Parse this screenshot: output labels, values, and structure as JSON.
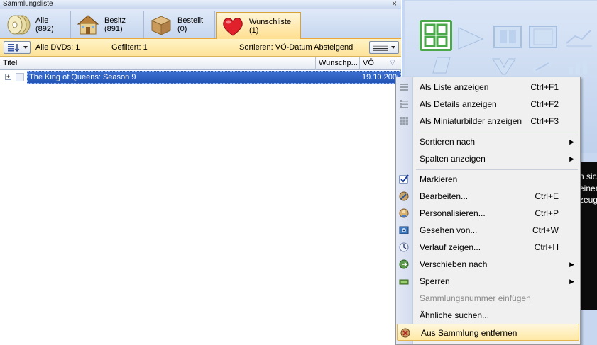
{
  "pane": {
    "title": "Sammlungsliste",
    "close_glyph": "×"
  },
  "tabs": [
    {
      "label": "Alle (892)",
      "icon": "discs-icon"
    },
    {
      "label": "Besitz (891)",
      "icon": "house-icon"
    },
    {
      "label": "Bestellt (0)",
      "icon": "box-icon"
    },
    {
      "label": "Wunschliste (1)",
      "icon": "heart-icon"
    }
  ],
  "infobar": {
    "all_dvds": "Alle DVDs: 1",
    "filtered": "Gefiltert: 1",
    "sort": "Sortieren: VÖ-Datum Absteigend"
  },
  "columns": {
    "title": "Titel",
    "wish": "Wunschp...",
    "release": "VÖ",
    "filter_glyph": "▽"
  },
  "rows": [
    {
      "expand": "+",
      "title": "The King of Queens: Season 9",
      "release": "19.10.2006"
    }
  ],
  "detail_fragments": [
    "n sic",
    "einer",
    "zeug"
  ],
  "menu": {
    "items": [
      {
        "label": "Als Liste anzeigen",
        "shortcut": "Ctrl+F1",
        "icon": "list-view-icon"
      },
      {
        "label": "Als Details anzeigen",
        "shortcut": "Ctrl+F2",
        "icon": "details-view-icon"
      },
      {
        "label": "Als Miniaturbilder anzeigen",
        "shortcut": "Ctrl+F3",
        "icon": "thumbnail-view-icon"
      },
      {
        "label": "Sortieren nach",
        "arrow": "▶"
      },
      {
        "label": "Spalten anzeigen",
        "arrow": "▶"
      },
      {
        "label": "Markieren",
        "icon": "checkbox-icon"
      },
      {
        "label": "Bearbeiten...",
        "shortcut": "Ctrl+E",
        "icon": "edit-icon"
      },
      {
        "label": "Personalisieren...",
        "shortcut": "Ctrl+P",
        "icon": "personalize-icon"
      },
      {
        "label": "Gesehen von...",
        "shortcut": "Ctrl+W",
        "icon": "seen-by-icon"
      },
      {
        "label": "Verlauf zeigen...",
        "shortcut": "Ctrl+H",
        "icon": "history-icon"
      },
      {
        "label": "Verschieben nach",
        "arrow": "▶",
        "icon": "move-icon"
      },
      {
        "label": "Sperren",
        "arrow": "▶",
        "icon": "lock-icon"
      },
      {
        "label": "Sammlungsnummer einfügen"
      },
      {
        "label": "Ähnliche suchen..."
      },
      {
        "label": "Aus Sammlung entfernen",
        "icon": "remove-icon"
      }
    ]
  },
  "colors": {
    "accent_tab": "#ffdf8f",
    "selection": "#2f5fc4",
    "menu_highlight": "#ffe9a6",
    "heart": "#e0202a"
  }
}
